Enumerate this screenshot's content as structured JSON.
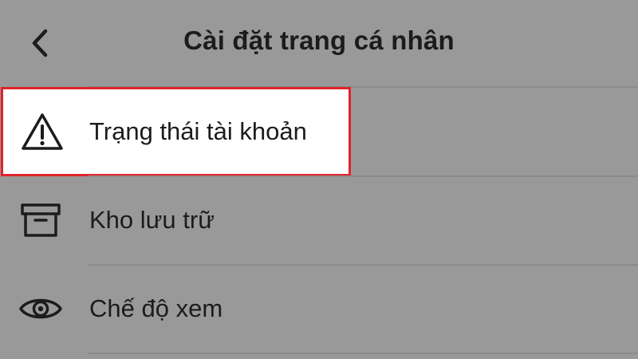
{
  "header": {
    "title": "Cài đặt trang cá nhân",
    "back_icon": "chevron-left-icon"
  },
  "menu": {
    "items": [
      {
        "label": "Trạng thái tài khoản",
        "icon": "warning-triangle-icon",
        "highlighted": true
      },
      {
        "label": "Kho lưu trữ",
        "icon": "archive-box-icon",
        "highlighted": false
      },
      {
        "label": "Chế độ xem",
        "icon": "eye-icon",
        "highlighted": false
      }
    ]
  },
  "colors": {
    "background": "#999999",
    "highlight_background": "#ffffff",
    "highlight_border": "#e0242b",
    "text": "#1c1c1c"
  }
}
